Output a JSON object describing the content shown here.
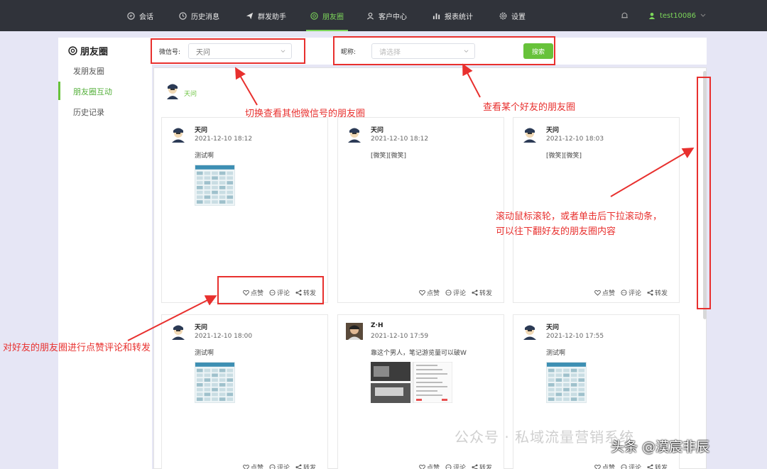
{
  "nav": {
    "items": [
      {
        "label": "会话",
        "icon": "chat-bubble-icon"
      },
      {
        "label": "历史消息",
        "icon": "clock-icon"
      },
      {
        "label": "群发助手",
        "icon": "send-icon"
      },
      {
        "label": "朋友圈",
        "icon": "aperture-icon"
      },
      {
        "label": "客户中心",
        "icon": "person-icon"
      },
      {
        "label": "报表统计",
        "icon": "bar-chart-icon"
      },
      {
        "label": "设置",
        "icon": "gear-icon"
      }
    ],
    "active_index": 3,
    "user": "test10086"
  },
  "sidebar": {
    "title": "朋友圈",
    "items": [
      "发朋友圈",
      "朋友圈互动",
      "历史记录"
    ],
    "active_index": 1
  },
  "search": {
    "wechat_label": "微信号:",
    "wechat_value": "天问",
    "nick_label": "昵称:",
    "nick_placeholder": "请选择",
    "button": "搜索"
  },
  "friend": {
    "name": "天问"
  },
  "posts": [
    {
      "name": "天问",
      "time": "2021-12-10 18:12",
      "text": "测试啊",
      "image": "table"
    },
    {
      "name": "天问",
      "time": "2021-12-10 18:12",
      "text": "[微笑][微笑]",
      "image": "none"
    },
    {
      "name": "天问",
      "time": "2021-12-10 18:03",
      "text": "[微笑][微笑]",
      "image": "none"
    },
    {
      "name": "天问",
      "time": "2021-12-10 18:00",
      "text": "测试啊",
      "image": "table"
    },
    {
      "name": "Z·H",
      "time": "2021-12-10 17:59",
      "text": "靠这个男人，笔记游览量可以破W",
      "image": "screens"
    },
    {
      "name": "天问",
      "time": "2021-12-10 17:55",
      "text": "测试啊",
      "image": "table"
    }
  ],
  "actions": {
    "like": "点赞",
    "comment": "评论",
    "share": "转发"
  },
  "annotations": {
    "switch_wechat": "切换查看其他微信号的朋友圈",
    "view_friend": "查看某个好友的朋友圈",
    "scroll_line1": "滚动鼠标滚轮，或者单击后下拉滚动条，",
    "scroll_line2": "可以往下翻好友的朋友圈内容",
    "interact": "对好友的朋友圈进行点赞评论和转发"
  },
  "watermark": "公众号 · 私域流量营销系统",
  "credit": "头条 @漠宸非辰",
  "colors": {
    "accent": "#67c23a",
    "nav_bg": "#30333a",
    "annotation": "#e8302e"
  }
}
